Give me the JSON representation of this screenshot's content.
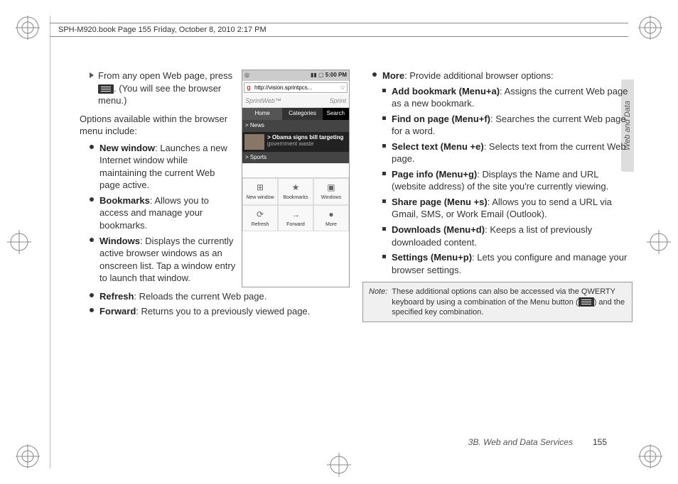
{
  "header": "SPH-M920.book  Page 155  Friday, October 8, 2010  2:17 PM",
  "intro1a": "From any open Web page, press ",
  "intro1b": ". (You will see the browser menu.)",
  "intro2": "Options available within the browser menu include:",
  "left_items": [
    {
      "b": "New window",
      "t": ": Launches a new Internet window while maintaining the current Web page active."
    },
    {
      "b": "Bookmarks",
      "t": ": Allows you to access and manage your bookmarks."
    },
    {
      "b": "Windows",
      "t": ": Displays the currently active browser windows as an onscreen list. Tap a window entry to launch that window."
    },
    {
      "b": "Refresh",
      "t": ": Reloads the current Web page."
    },
    {
      "b": "Forward",
      "t": ": Returns you to a previously viewed page."
    }
  ],
  "more": {
    "b": "More",
    "t": ": Provide additional browser options:"
  },
  "more_items": [
    {
      "b": "Add bookmark (Menu+a)",
      "t": ": Assigns the current Web page as a new bookmark."
    },
    {
      "b": "Find on page (Menu+f)",
      "t": ": Searches the current Web page for a word."
    },
    {
      "b": "Select text (Menu +e)",
      "t": ": Selects text from the current Web page."
    },
    {
      "b": "Page info (Menu+g)",
      "t": ": Displays the Name and URL (website address) of the site you're currently viewing."
    },
    {
      "b": "Share page (Menu +s)",
      "t": ": Allows you to send a URL via Gmail, SMS, or Work Email (Outlook)."
    },
    {
      "b": "Downloads (Menu+d)",
      "t": ": Keeps a list of previously downloaded content."
    },
    {
      "b": "Settings (Menu+p)",
      "t": ": Lets you configure and manage your browser settings."
    }
  ],
  "note_lbl": "Note:",
  "note_a": "These additional options can also be accessed via the QWERTY keyboard by using a combination of the Menu button (",
  "note_b": ") and the specified key combination.",
  "side": "Web and Data",
  "footer_section": "3B. Web and Data Services",
  "footer_page": "155",
  "phone": {
    "time": "5:00 PM",
    "url": "http://vision.sprintpcs...",
    "brand_l": "SprintWeb™",
    "brand_r": "Sprint",
    "tab1": "Home",
    "tab2": "Categories",
    "search": "Search",
    "cat1": "> News",
    "news_a": "> Obama signs bill targeting ",
    "news_b": "government waste",
    "cat2": "> Sports",
    "menu": [
      "New window",
      "Bookmarks",
      "Windows",
      "Refresh",
      "Forward",
      "More"
    ]
  }
}
